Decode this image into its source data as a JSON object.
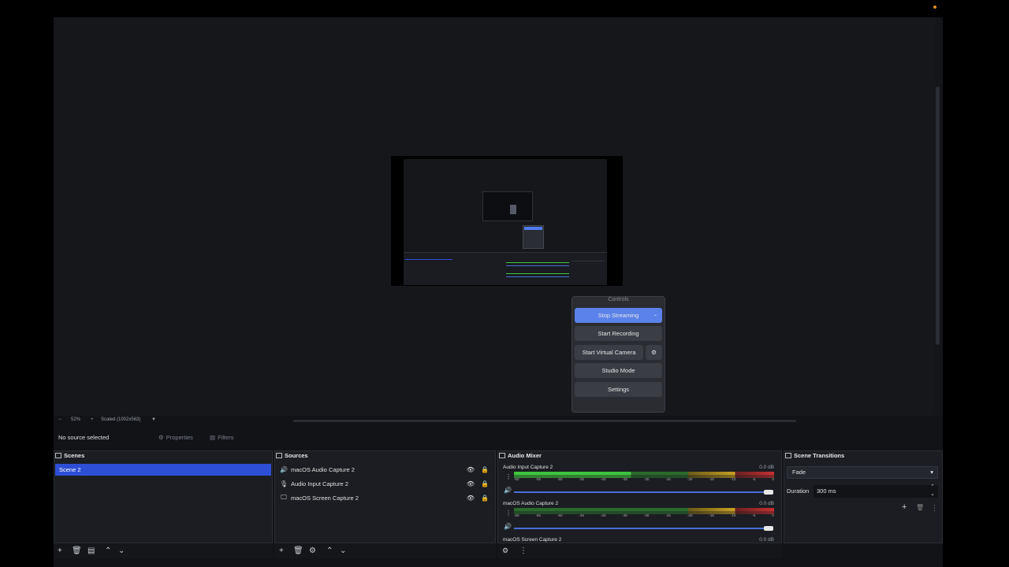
{
  "preview": {
    "zoom": "52%",
    "scale_mode": "Scaled (1002x563)"
  },
  "controls": {
    "title": "Controls",
    "stop_streaming": "Stop Streaming",
    "start_recording": "Start Recording",
    "start_virtual_camera": "Start Virtual Camera",
    "studio_mode": "Studio Mode",
    "settings": "Settings"
  },
  "source_bar": {
    "status": "No source selected",
    "properties": "Properties",
    "filters": "Filters"
  },
  "scenes": {
    "title": "Scenes",
    "items": [
      "Scene 2"
    ]
  },
  "sources": {
    "title": "Sources",
    "items": [
      {
        "name": "macOS Audio Capture 2",
        "icon": "speaker-icon"
      },
      {
        "name": "Audio Input Capture 2",
        "icon": "microphone-icon"
      },
      {
        "name": "macOS Screen Capture 2",
        "icon": "monitor-icon"
      }
    ]
  },
  "mixer": {
    "title": "Audio Mixer",
    "channels": [
      {
        "name": "Audio Input Capture 2",
        "db": "0.0 dB",
        "level": 0.45
      },
      {
        "name": "macOS Audio Capture 2",
        "db": "0.0 dB",
        "level": 0
      },
      {
        "name": "macOS Screen Capture 2",
        "db": "0.0 dB",
        "level": 0
      }
    ],
    "ticks": [
      "-60",
      "-55",
      "-50",
      "-45",
      "-40",
      "-35",
      "-30",
      "-25",
      "-20",
      "-15",
      "-10",
      "-5",
      "0"
    ]
  },
  "transitions": {
    "title": "Scene Transitions",
    "selected": "Fade",
    "duration_label": "Duration",
    "duration_value": "300 ms"
  },
  "colors": {
    "accent": "#5a82ea",
    "selection": "#2d4fd6",
    "meter_green": "#3ec43e",
    "meter_yellow": "#c8a020",
    "meter_red": "#c83030"
  }
}
